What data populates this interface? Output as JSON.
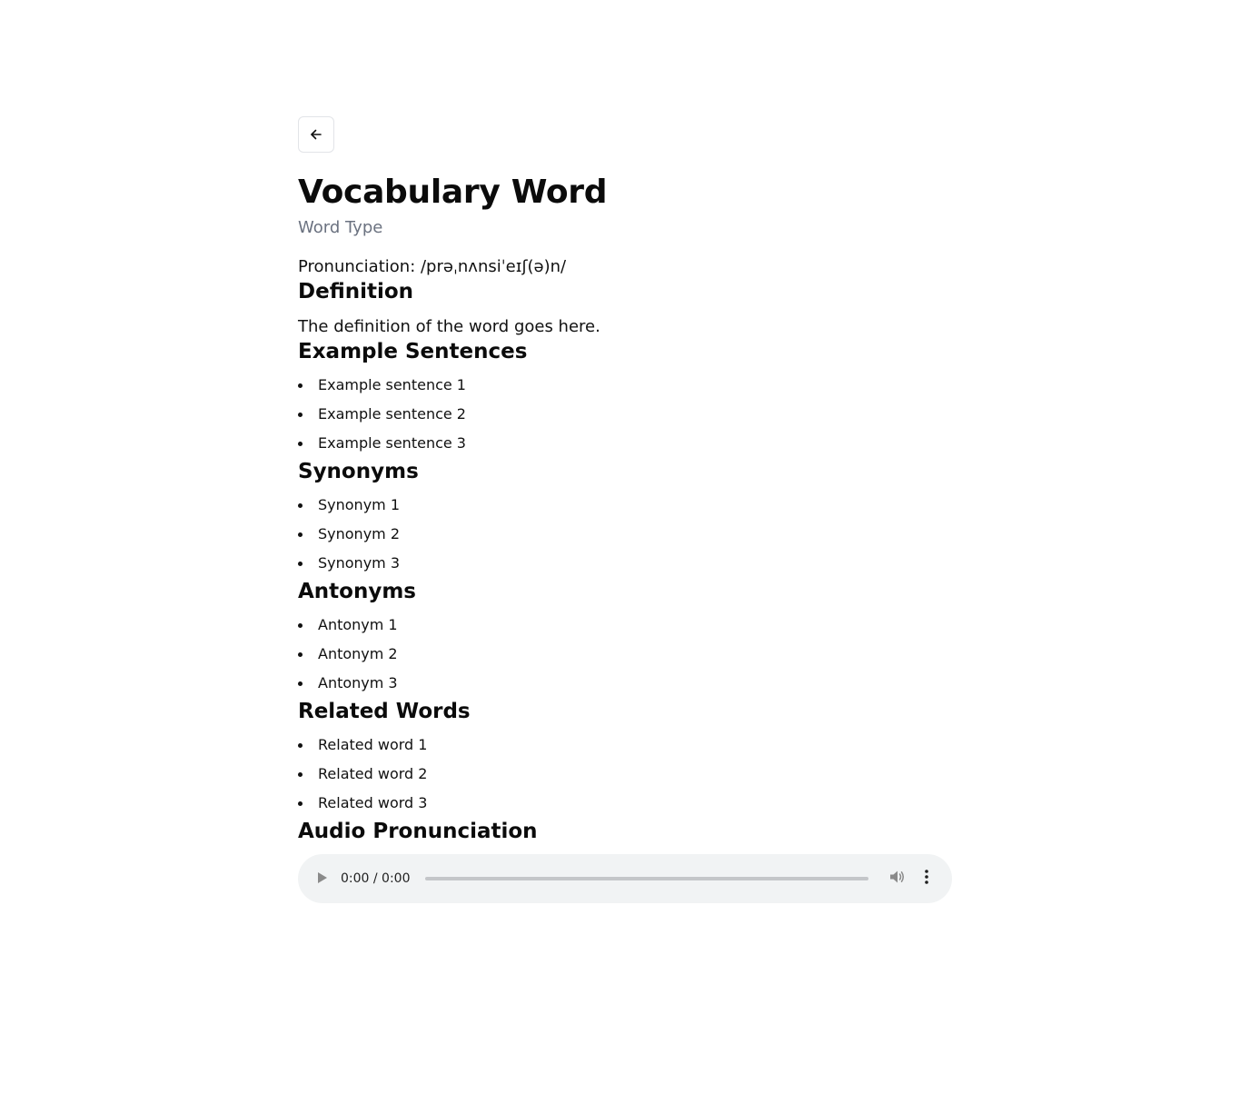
{
  "header": {
    "back_icon": "arrow-left-icon"
  },
  "word": {
    "title": "Vocabulary Word",
    "type": "Word Type",
    "pronunciation": "Pronunciation: /prəˌnʌnsiˈeɪʃ(ə)n/"
  },
  "definition": {
    "heading": "Definition",
    "text": "The definition of the word goes here."
  },
  "examples": {
    "heading": "Example Sentences",
    "items": [
      "Example sentence 1",
      "Example sentence 2",
      "Example sentence 3"
    ]
  },
  "synonyms": {
    "heading": "Synonyms",
    "items": [
      "Synonym 1",
      "Synonym 2",
      "Synonym 3"
    ]
  },
  "antonyms": {
    "heading": "Antonyms",
    "items": [
      "Antonym 1",
      "Antonym 2",
      "Antonym 3"
    ]
  },
  "related": {
    "heading": "Related Words",
    "items": [
      "Related word 1",
      "Related word 2",
      "Related word 3"
    ]
  },
  "audio": {
    "heading": "Audio Pronunciation",
    "time": "0:00 / 0:00",
    "progress": 0,
    "icons": {
      "play": "play-icon",
      "volume": "volume-icon",
      "menu": "more-vertical-icon"
    }
  },
  "colors": {
    "text": "#111111",
    "muted": "#6b7280",
    "audio_bg": "#f1f3f4",
    "border": "#e2e4e8"
  }
}
